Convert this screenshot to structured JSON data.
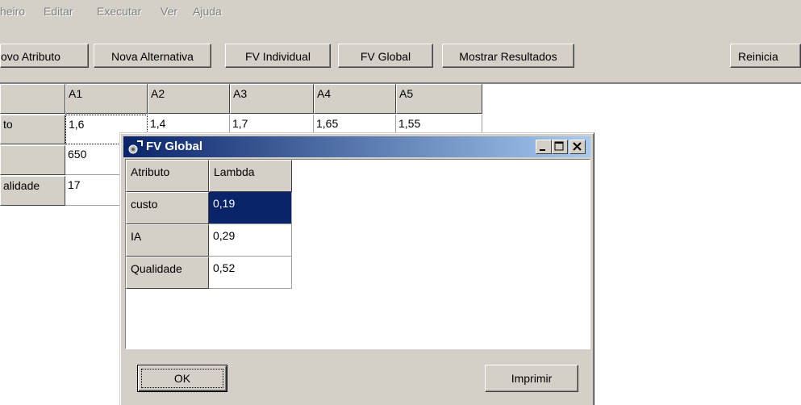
{
  "menu": [
    "heiro",
    "Editar",
    "Executar",
    "Ver",
    "Ajuda"
  ],
  "toolbar": {
    "novo_atributo": "ovo Atributo",
    "nova_alternativa": "Nova Alternativa",
    "fv_individual": "FV Individual",
    "fv_global": "FV Global",
    "mostrar_resultados": "Mostrar Resultados",
    "reiniciar": "Reinicia"
  },
  "grid": {
    "columns": [
      "A1",
      "A2",
      "A3",
      "A4",
      "A5"
    ],
    "rows": [
      {
        "label": "to",
        "values": [
          "1,6",
          "1,4",
          "1,7",
          "1,65",
          "1,55"
        ]
      },
      {
        "label": "",
        "values": [
          "650",
          "",
          "",
          "",
          ""
        ]
      },
      {
        "label": "alidade",
        "values": [
          "17",
          "",
          "",
          "",
          ""
        ]
      }
    ]
  },
  "dialog": {
    "title": "FV Global",
    "headers": [
      "Atributo",
      "Lambda"
    ],
    "rows": [
      {
        "atributo": "custo",
        "lambda": "0,19"
      },
      {
        "atributo": "IA",
        "lambda": "0,29"
      },
      {
        "atributo": "Qualidade",
        "lambda": "0,52"
      }
    ],
    "ok_label": "OK",
    "imprimir_label": "Imprimir"
  }
}
